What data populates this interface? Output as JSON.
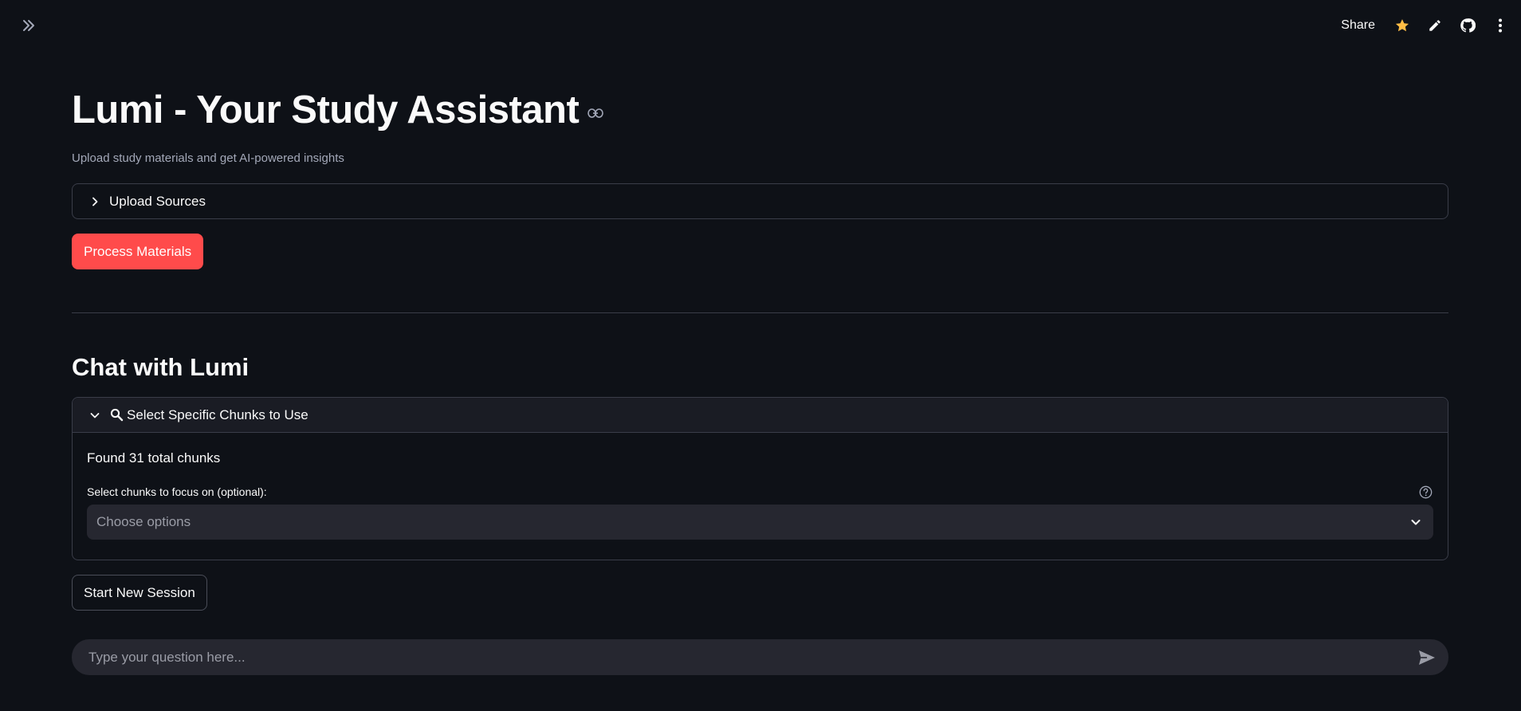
{
  "header": {
    "share_label": "Share",
    "icons": [
      "sidebar-expand-icon",
      "star-icon",
      "pencil-icon",
      "github-icon",
      "more-vertical-icon"
    ],
    "star_color": "#ffbd45"
  },
  "main": {
    "title": "Lumi - Your Study Assistant",
    "subtitle": "Upload study materials and get AI-powered insights",
    "upload_expander": {
      "label": "Upload Sources",
      "expanded": false
    },
    "process_button": "Process Materials",
    "chat_section_title": "Chat with Lumi",
    "chunks_expander": {
      "label": "Select Specific Chunks to Use",
      "expanded": true,
      "found_text": "Found 31 total chunks",
      "select_label": "Select chunks to focus on (optional):",
      "select_placeholder": "Choose options"
    },
    "new_session_button": "Start New Session",
    "chat_input_placeholder": "Type your question here..."
  },
  "colors": {
    "background": "#0e1117",
    "primary": "#ff4b4b",
    "input_bg": "#262730",
    "border": "#3a3d49"
  }
}
